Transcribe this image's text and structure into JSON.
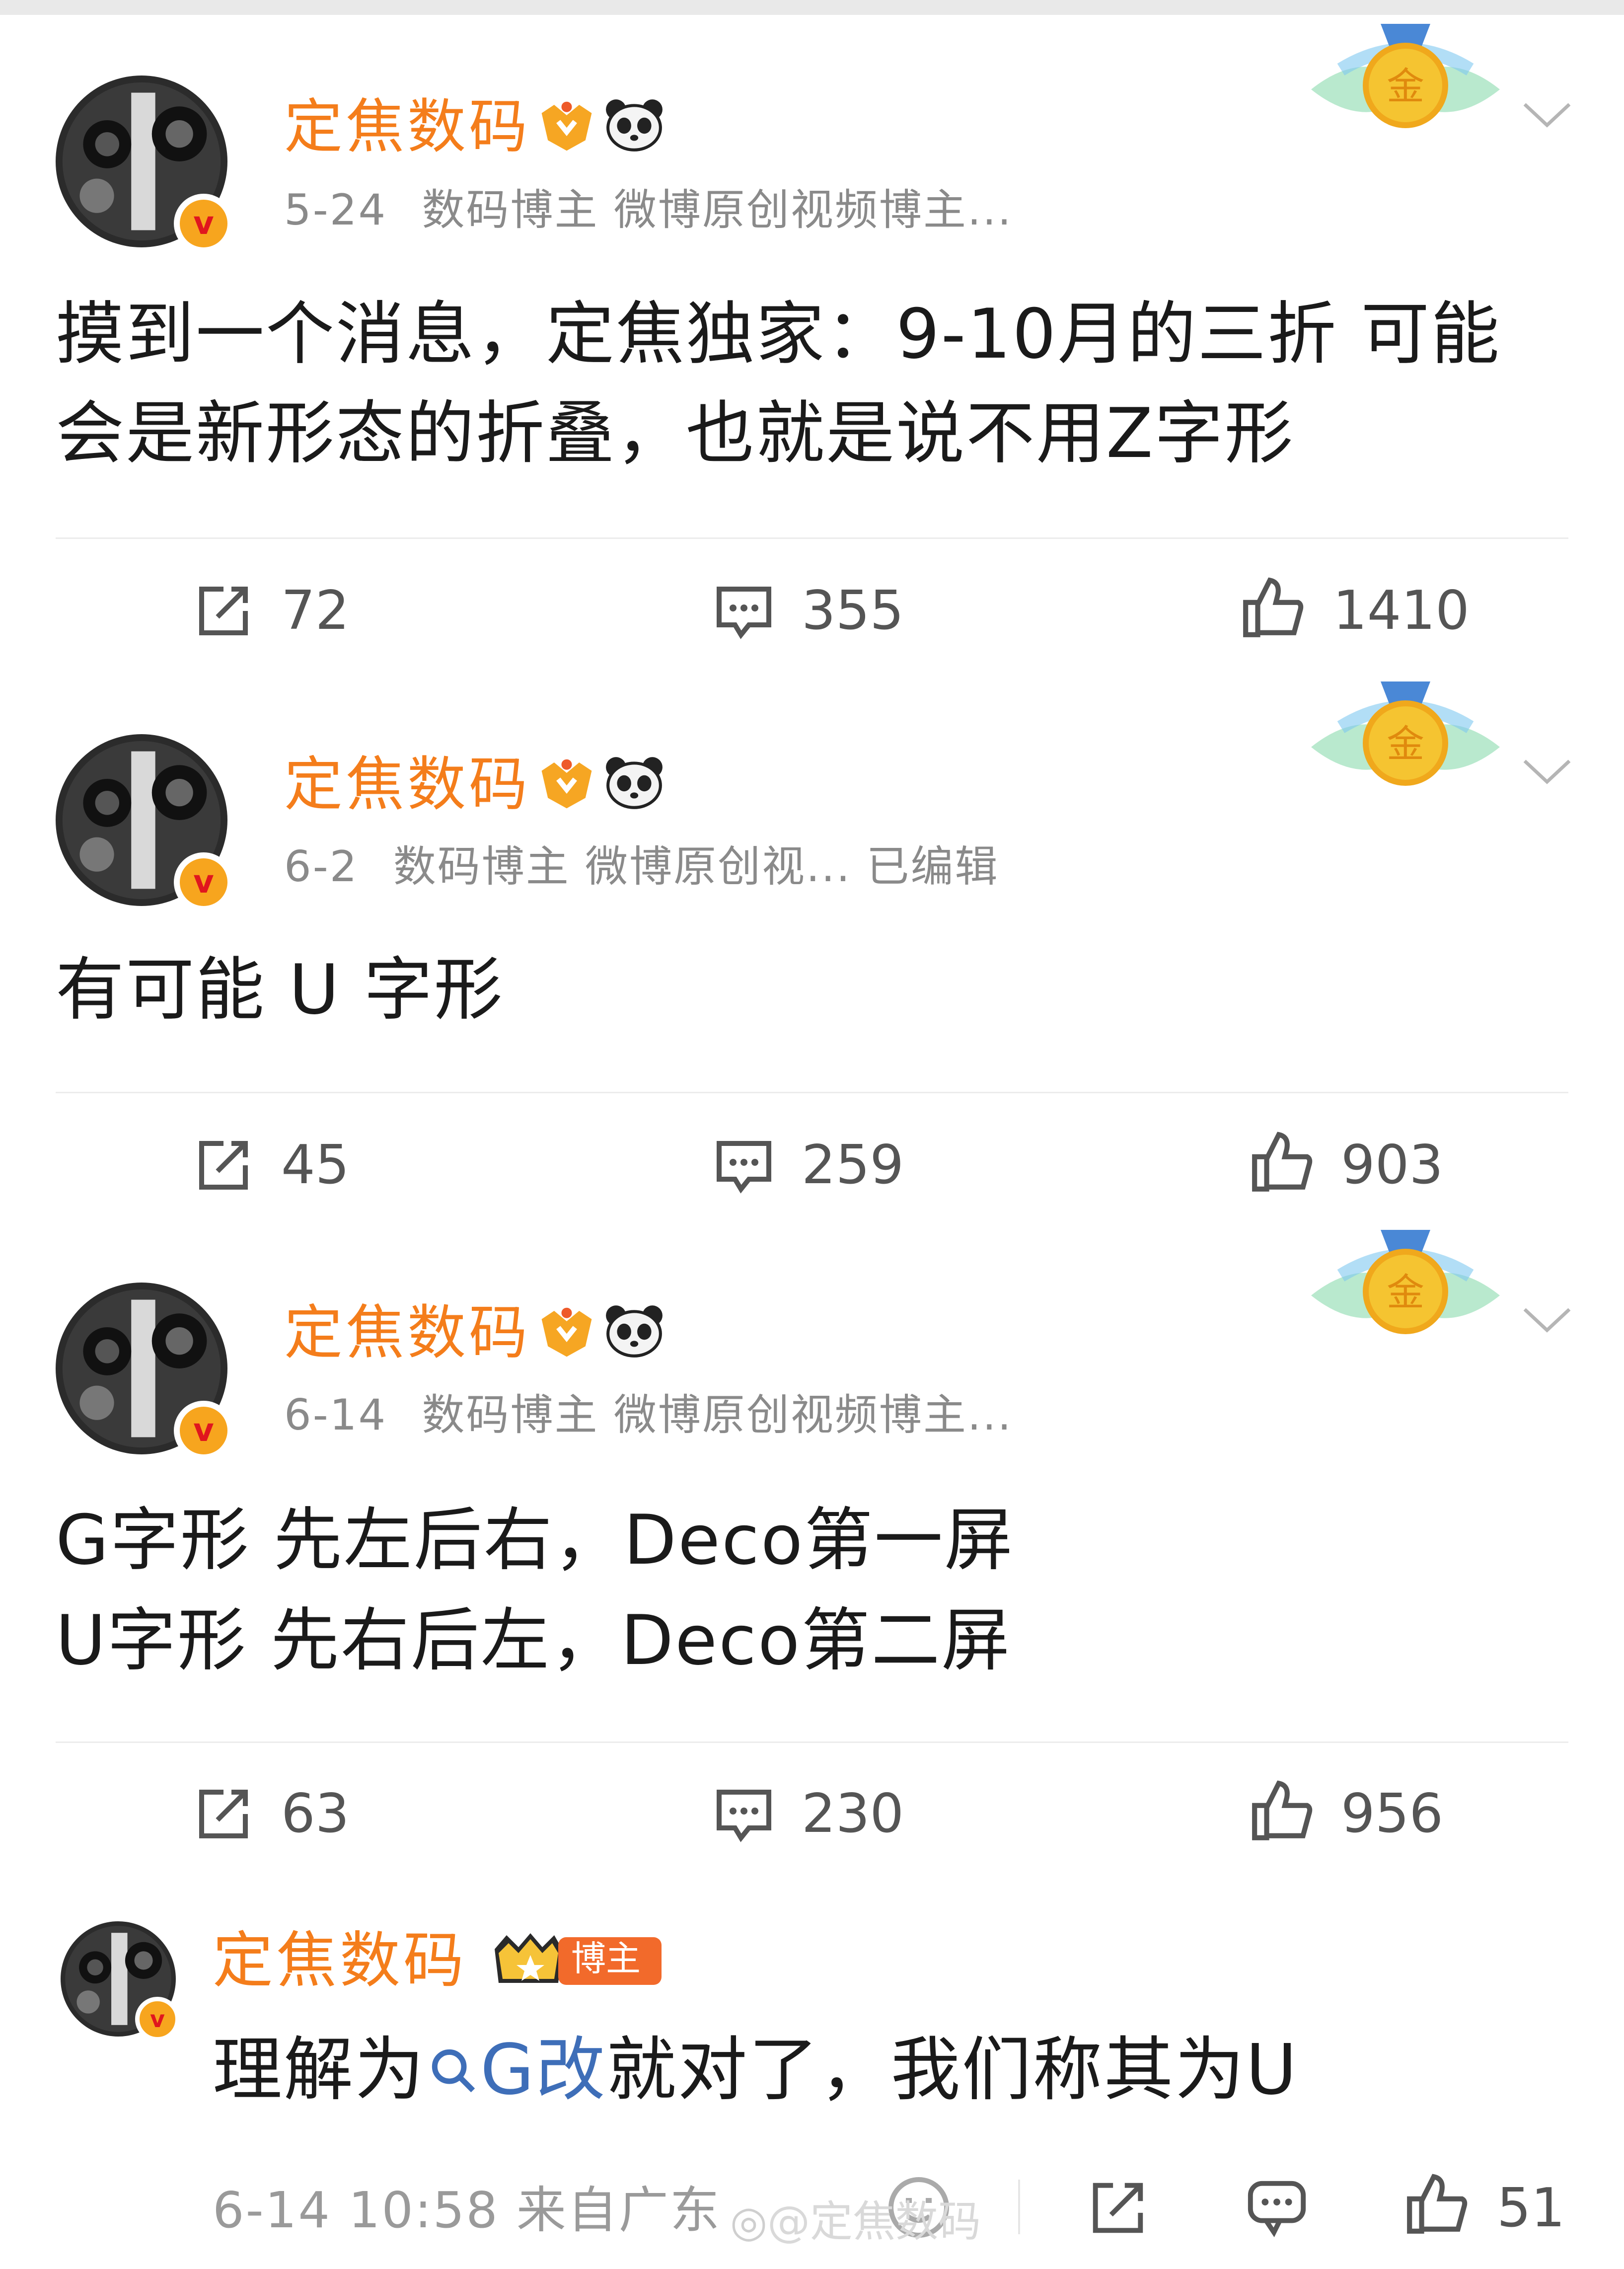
{
  "posts": [
    {
      "author": "定焦数码",
      "date": "5-24",
      "meta": "数码博主 微博原创视频博主...",
      "lines": [
        "摸到一个消息，定焦独家：9-10月的三折 可能",
        "会是新形态的折叠，也就是说不用Z字形"
      ],
      "reposts": "72",
      "comments": "355",
      "likes": "1410",
      "medal_label": "金"
    },
    {
      "author": "定焦数码",
      "date": "6-2",
      "meta": "数码博主 微博原创视... 已编辑",
      "lines": [
        "有可能 U 字形"
      ],
      "reposts": "45",
      "comments": "259",
      "likes": "903",
      "medal_label": "金"
    },
    {
      "author": "定焦数码",
      "date": "6-14",
      "meta": "数码博主 微博原创视频博主...",
      "lines": [
        "G字形 先左后右，Deco第一屏",
        "U字形 先右后左，Deco第二屏"
      ],
      "reposts": "63",
      "comments": "230",
      "likes": "956",
      "medal_label": "金"
    }
  ],
  "reply": {
    "author": "定焦数码",
    "badge_label": "博主",
    "text_before": "理解为",
    "link_text": "G改",
    "text_after": "就对了，我们称其为U",
    "timestamp": "6-14 10:58 来自广东",
    "likes": "51"
  },
  "watermark": "@定焦数码",
  "colors": {
    "name": "#f47d1b",
    "meta": "#8a8a8a",
    "link": "#3e6eb8",
    "verified": "#f7a51e"
  }
}
